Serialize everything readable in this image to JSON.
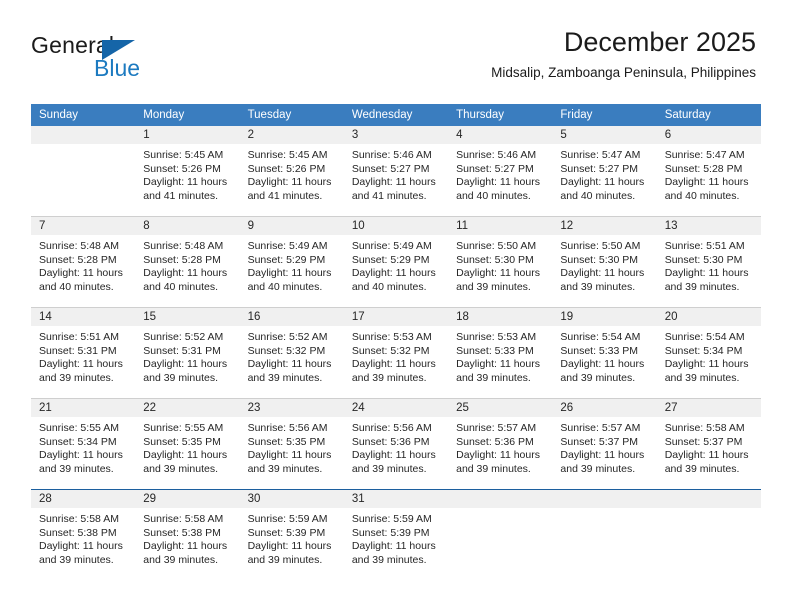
{
  "logo": {
    "word_one": "General",
    "word_two": "Blue",
    "triangle_color": "#1565a8",
    "blue_text_color": "#1c7ac0"
  },
  "header": {
    "title": "December 2025",
    "subtitle": "Midsalip, Zamboanga Peninsula, Philippines"
  },
  "theme": {
    "header_row_bg": "#3a7dbf",
    "day_number_bg": "#f0f0f0",
    "week_divider": "#cfcfcf",
    "last_row_divider": "#1c5f9e",
    "text": "#262626"
  },
  "weekdays": [
    "Sunday",
    "Monday",
    "Tuesday",
    "Wednesday",
    "Thursday",
    "Friday",
    "Saturday"
  ],
  "weeks": [
    [
      {
        "day": "",
        "sunrise": "",
        "sunset": "",
        "daylight_line1": "",
        "daylight_line2": ""
      },
      {
        "day": "1",
        "sunrise": "Sunrise: 5:45 AM",
        "sunset": "Sunset: 5:26 PM",
        "daylight_line1": "Daylight: 11 hours",
        "daylight_line2": "and 41 minutes."
      },
      {
        "day": "2",
        "sunrise": "Sunrise: 5:45 AM",
        "sunset": "Sunset: 5:26 PM",
        "daylight_line1": "Daylight: 11 hours",
        "daylight_line2": "and 41 minutes."
      },
      {
        "day": "3",
        "sunrise": "Sunrise: 5:46 AM",
        "sunset": "Sunset: 5:27 PM",
        "daylight_line1": "Daylight: 11 hours",
        "daylight_line2": "and 41 minutes."
      },
      {
        "day": "4",
        "sunrise": "Sunrise: 5:46 AM",
        "sunset": "Sunset: 5:27 PM",
        "daylight_line1": "Daylight: 11 hours",
        "daylight_line2": "and 40 minutes."
      },
      {
        "day": "5",
        "sunrise": "Sunrise: 5:47 AM",
        "sunset": "Sunset: 5:27 PM",
        "daylight_line1": "Daylight: 11 hours",
        "daylight_line2": "and 40 minutes."
      },
      {
        "day": "6",
        "sunrise": "Sunrise: 5:47 AM",
        "sunset": "Sunset: 5:28 PM",
        "daylight_line1": "Daylight: 11 hours",
        "daylight_line2": "and 40 minutes."
      }
    ],
    [
      {
        "day": "7",
        "sunrise": "Sunrise: 5:48 AM",
        "sunset": "Sunset: 5:28 PM",
        "daylight_line1": "Daylight: 11 hours",
        "daylight_line2": "and 40 minutes."
      },
      {
        "day": "8",
        "sunrise": "Sunrise: 5:48 AM",
        "sunset": "Sunset: 5:28 PM",
        "daylight_line1": "Daylight: 11 hours",
        "daylight_line2": "and 40 minutes."
      },
      {
        "day": "9",
        "sunrise": "Sunrise: 5:49 AM",
        "sunset": "Sunset: 5:29 PM",
        "daylight_line1": "Daylight: 11 hours",
        "daylight_line2": "and 40 minutes."
      },
      {
        "day": "10",
        "sunrise": "Sunrise: 5:49 AM",
        "sunset": "Sunset: 5:29 PM",
        "daylight_line1": "Daylight: 11 hours",
        "daylight_line2": "and 40 minutes."
      },
      {
        "day": "11",
        "sunrise": "Sunrise: 5:50 AM",
        "sunset": "Sunset: 5:30 PM",
        "daylight_line1": "Daylight: 11 hours",
        "daylight_line2": "and 39 minutes."
      },
      {
        "day": "12",
        "sunrise": "Sunrise: 5:50 AM",
        "sunset": "Sunset: 5:30 PM",
        "daylight_line1": "Daylight: 11 hours",
        "daylight_line2": "and 39 minutes."
      },
      {
        "day": "13",
        "sunrise": "Sunrise: 5:51 AM",
        "sunset": "Sunset: 5:30 PM",
        "daylight_line1": "Daylight: 11 hours",
        "daylight_line2": "and 39 minutes."
      }
    ],
    [
      {
        "day": "14",
        "sunrise": "Sunrise: 5:51 AM",
        "sunset": "Sunset: 5:31 PM",
        "daylight_line1": "Daylight: 11 hours",
        "daylight_line2": "and 39 minutes."
      },
      {
        "day": "15",
        "sunrise": "Sunrise: 5:52 AM",
        "sunset": "Sunset: 5:31 PM",
        "daylight_line1": "Daylight: 11 hours",
        "daylight_line2": "and 39 minutes."
      },
      {
        "day": "16",
        "sunrise": "Sunrise: 5:52 AM",
        "sunset": "Sunset: 5:32 PM",
        "daylight_line1": "Daylight: 11 hours",
        "daylight_line2": "and 39 minutes."
      },
      {
        "day": "17",
        "sunrise": "Sunrise: 5:53 AM",
        "sunset": "Sunset: 5:32 PM",
        "daylight_line1": "Daylight: 11 hours",
        "daylight_line2": "and 39 minutes."
      },
      {
        "day": "18",
        "sunrise": "Sunrise: 5:53 AM",
        "sunset": "Sunset: 5:33 PM",
        "daylight_line1": "Daylight: 11 hours",
        "daylight_line2": "and 39 minutes."
      },
      {
        "day": "19",
        "sunrise": "Sunrise: 5:54 AM",
        "sunset": "Sunset: 5:33 PM",
        "daylight_line1": "Daylight: 11 hours",
        "daylight_line2": "and 39 minutes."
      },
      {
        "day": "20",
        "sunrise": "Sunrise: 5:54 AM",
        "sunset": "Sunset: 5:34 PM",
        "daylight_line1": "Daylight: 11 hours",
        "daylight_line2": "and 39 minutes."
      }
    ],
    [
      {
        "day": "21",
        "sunrise": "Sunrise: 5:55 AM",
        "sunset": "Sunset: 5:34 PM",
        "daylight_line1": "Daylight: 11 hours",
        "daylight_line2": "and 39 minutes."
      },
      {
        "day": "22",
        "sunrise": "Sunrise: 5:55 AM",
        "sunset": "Sunset: 5:35 PM",
        "daylight_line1": "Daylight: 11 hours",
        "daylight_line2": "and 39 minutes."
      },
      {
        "day": "23",
        "sunrise": "Sunrise: 5:56 AM",
        "sunset": "Sunset: 5:35 PM",
        "daylight_line1": "Daylight: 11 hours",
        "daylight_line2": "and 39 minutes."
      },
      {
        "day": "24",
        "sunrise": "Sunrise: 5:56 AM",
        "sunset": "Sunset: 5:36 PM",
        "daylight_line1": "Daylight: 11 hours",
        "daylight_line2": "and 39 minutes."
      },
      {
        "day": "25",
        "sunrise": "Sunrise: 5:57 AM",
        "sunset": "Sunset: 5:36 PM",
        "daylight_line1": "Daylight: 11 hours",
        "daylight_line2": "and 39 minutes."
      },
      {
        "day": "26",
        "sunrise": "Sunrise: 5:57 AM",
        "sunset": "Sunset: 5:37 PM",
        "daylight_line1": "Daylight: 11 hours",
        "daylight_line2": "and 39 minutes."
      },
      {
        "day": "27",
        "sunrise": "Sunrise: 5:58 AM",
        "sunset": "Sunset: 5:37 PM",
        "daylight_line1": "Daylight: 11 hours",
        "daylight_line2": "and 39 minutes."
      }
    ],
    [
      {
        "day": "28",
        "sunrise": "Sunrise: 5:58 AM",
        "sunset": "Sunset: 5:38 PM",
        "daylight_line1": "Daylight: 11 hours",
        "daylight_line2": "and 39 minutes."
      },
      {
        "day": "29",
        "sunrise": "Sunrise: 5:58 AM",
        "sunset": "Sunset: 5:38 PM",
        "daylight_line1": "Daylight: 11 hours",
        "daylight_line2": "and 39 minutes."
      },
      {
        "day": "30",
        "sunrise": "Sunrise: 5:59 AM",
        "sunset": "Sunset: 5:39 PM",
        "daylight_line1": "Daylight: 11 hours",
        "daylight_line2": "and 39 minutes."
      },
      {
        "day": "31",
        "sunrise": "Sunrise: 5:59 AM",
        "sunset": "Sunset: 5:39 PM",
        "daylight_line1": "Daylight: 11 hours",
        "daylight_line2": "and 39 minutes."
      },
      {
        "day": "",
        "sunrise": "",
        "sunset": "",
        "daylight_line1": "",
        "daylight_line2": ""
      },
      {
        "day": "",
        "sunrise": "",
        "sunset": "",
        "daylight_line1": "",
        "daylight_line2": ""
      },
      {
        "day": "",
        "sunrise": "",
        "sunset": "",
        "daylight_line1": "",
        "daylight_line2": ""
      }
    ]
  ]
}
